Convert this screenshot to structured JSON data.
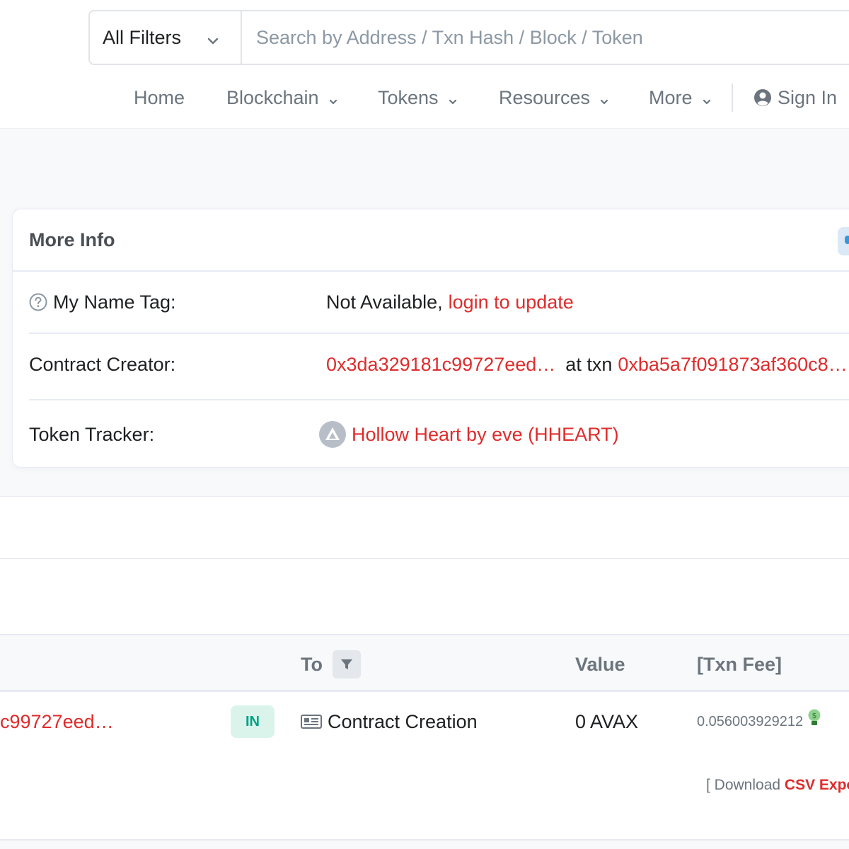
{
  "search": {
    "filter_label": "All Filters",
    "placeholder": "Search by Address / Txn Hash / Block / Token"
  },
  "nav": {
    "home": "Home",
    "blockchain": "Blockchain",
    "tokens": "Tokens",
    "resources": "Resources",
    "more": "More",
    "sign_in": "Sign In"
  },
  "more_info": {
    "title": "More Info",
    "name_tag_label": "My Name Tag:",
    "name_tag_value": "Not Available,",
    "name_tag_link": "login to update",
    "creator_label": "Contract Creator:",
    "creator_address": "0x3da329181c99727eed…",
    "creator_at_txn": "at txn",
    "creator_txn": "0xba5a7f091873af360c8…",
    "tracker_label": "Token Tracker:",
    "tracker_value": "Hollow Heart by eve (HHEART)"
  },
  "table": {
    "headers": {
      "to": "To",
      "value": "Value",
      "fee": "[Txn Fee]"
    },
    "rows": [
      {
        "from": "c99727eed…",
        "direction": "IN",
        "to": "Contract Creation",
        "value": "0 AVAX",
        "fee": "0.056003929212"
      }
    ]
  },
  "download": {
    "prefix": "[ Download",
    "link": "CSV Expo"
  },
  "colors": {
    "link_red": "#de2c2c",
    "in_green": "#00a186",
    "muted": "#6c757e"
  }
}
